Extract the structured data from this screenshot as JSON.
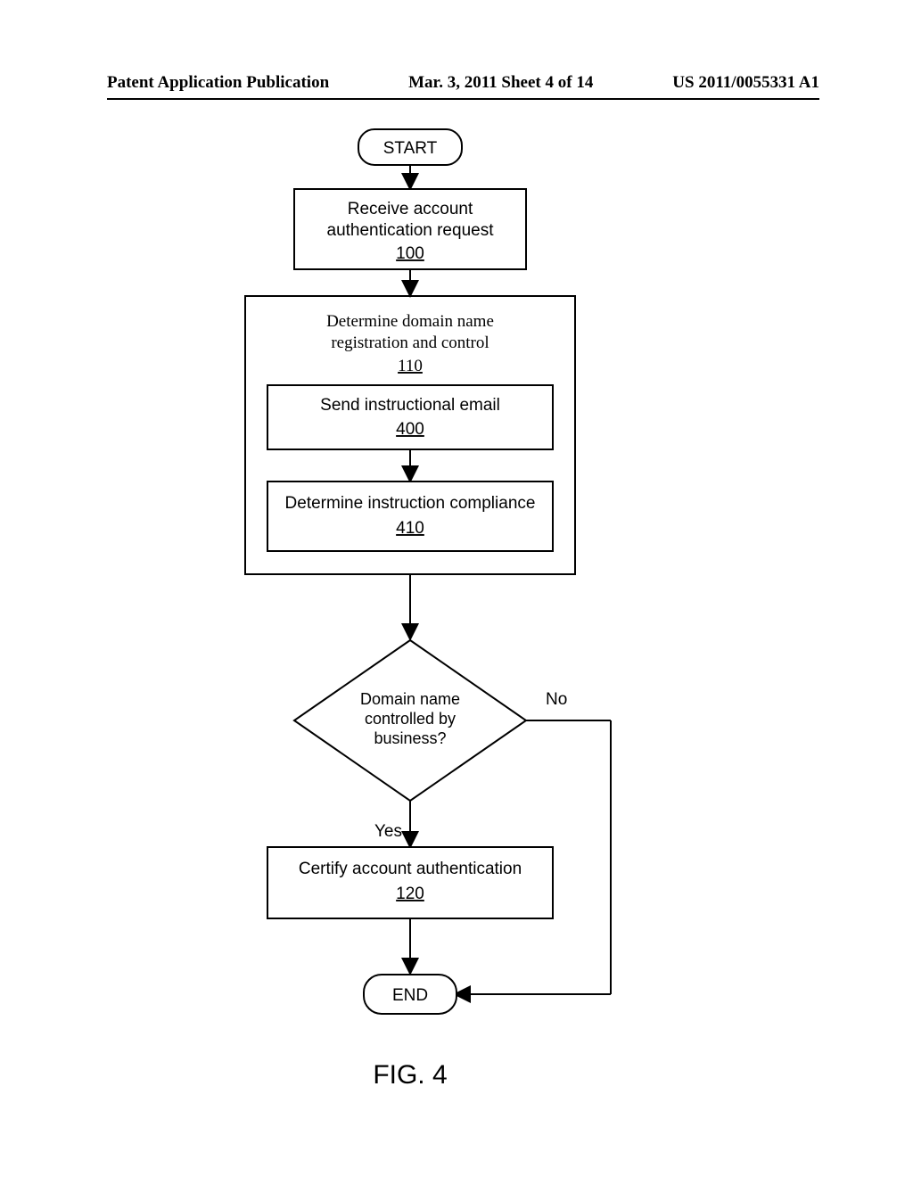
{
  "header": {
    "left": "Patent Application Publication",
    "center": "Mar. 3, 2011  Sheet 4 of 14",
    "right": "US 2011/0055331 A1"
  },
  "nodes": {
    "start": "START",
    "step100": {
      "line1": "Receive account",
      "line2": "authentication request",
      "ref": "100"
    },
    "step110": {
      "line1": "Determine domain name",
      "line2": "registration and control",
      "ref": "110"
    },
    "step400": {
      "line1": "Send instructional email",
      "ref": "400"
    },
    "step410": {
      "line1": "Determine instruction compliance",
      "ref": "410"
    },
    "decision": {
      "line1": "Domain name",
      "line2": "controlled by",
      "line3": "business?"
    },
    "yes": "Yes",
    "no": "No",
    "step120": {
      "line1": "Certify account authentication",
      "ref": "120"
    },
    "end": "END"
  },
  "figure_label": "FIG. 4"
}
